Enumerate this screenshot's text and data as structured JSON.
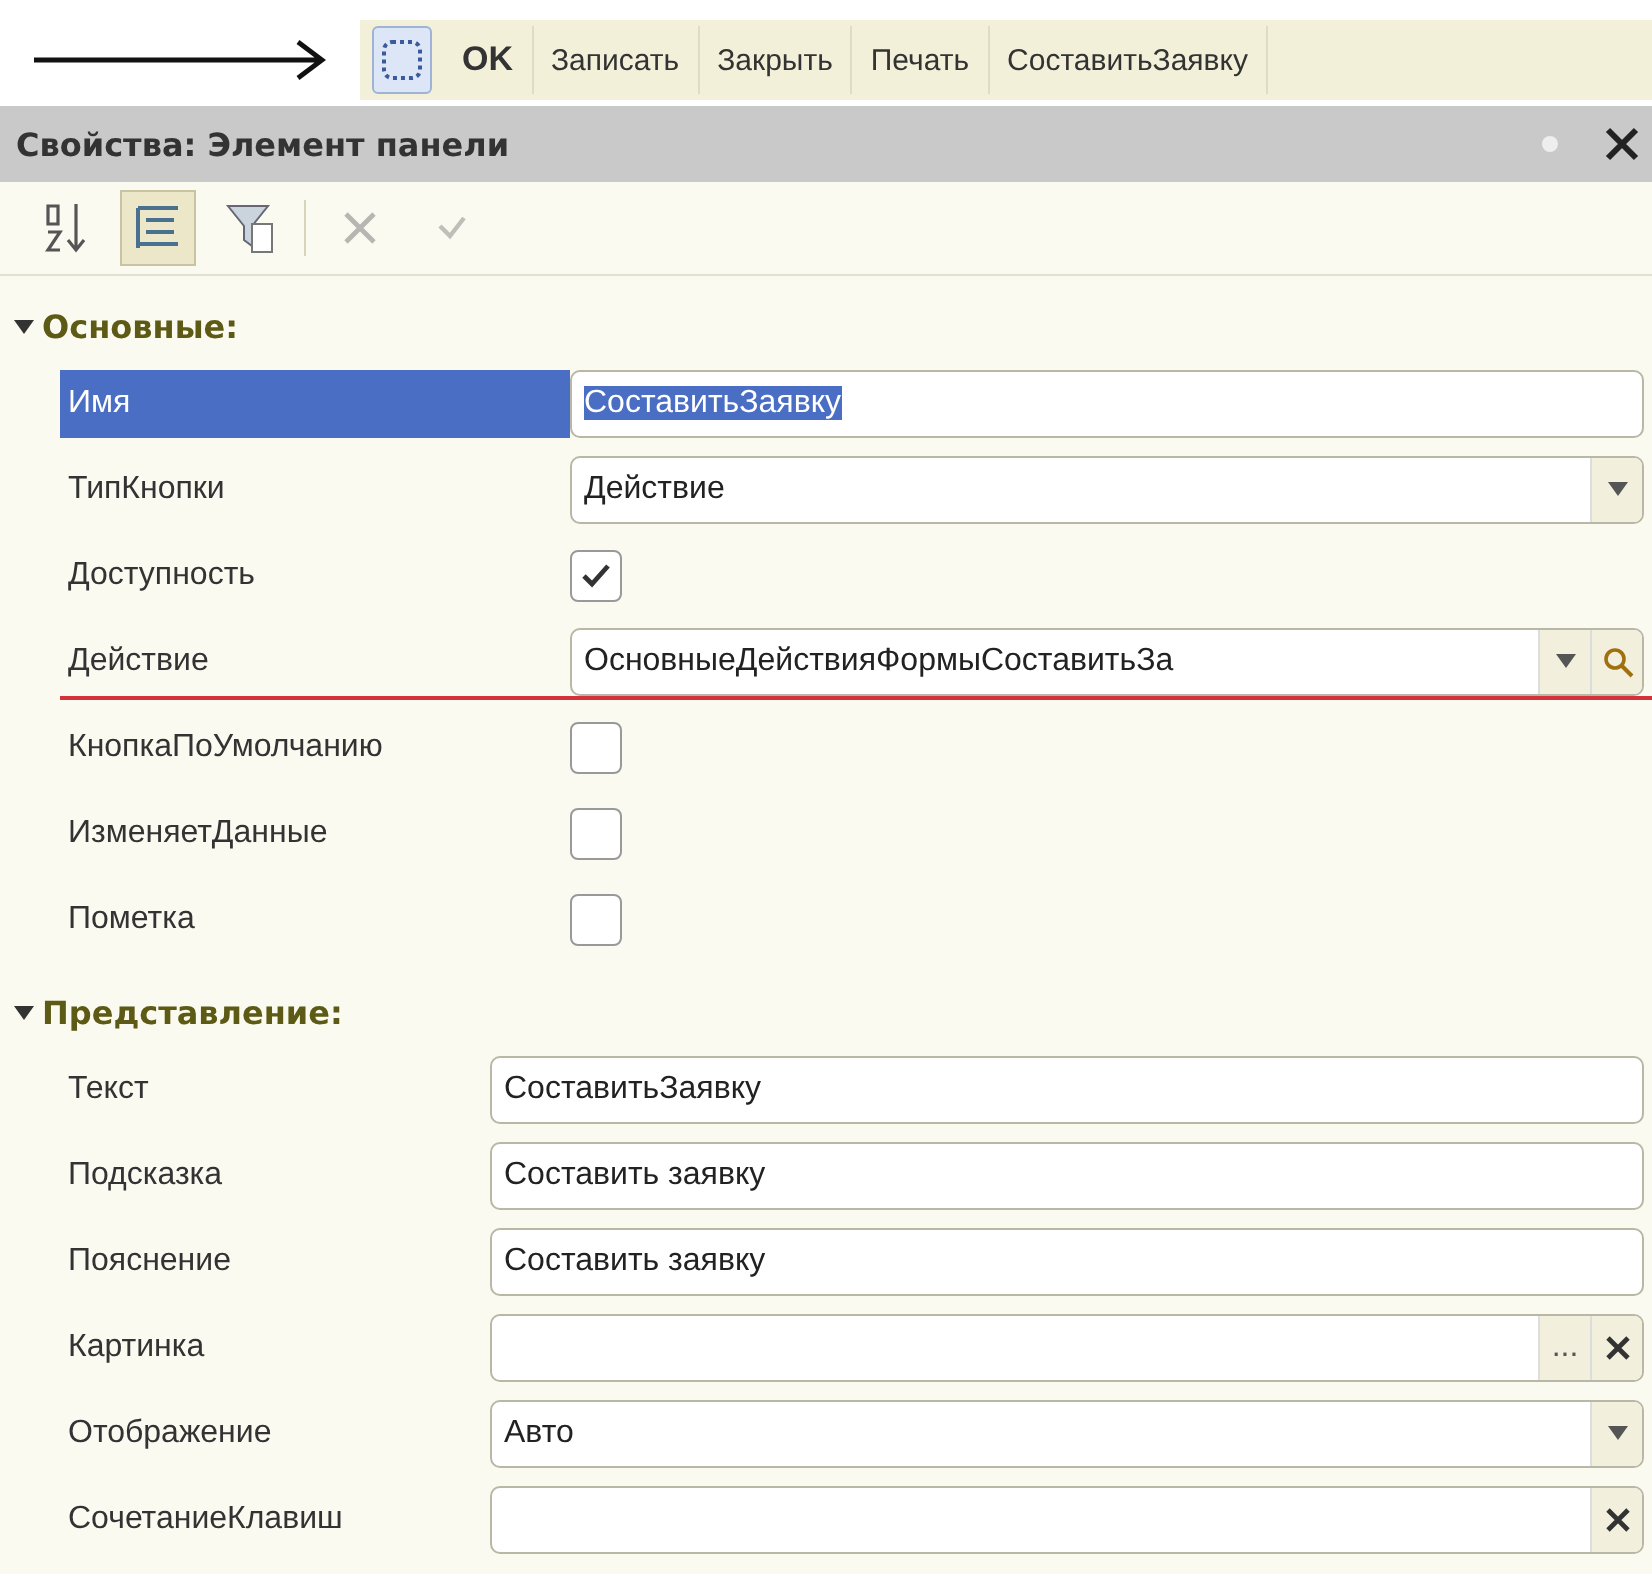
{
  "command_bar": {
    "items": [
      {
        "kind": "icon",
        "selected": true
      },
      {
        "kind": "text",
        "label": "OK",
        "bold": true
      },
      {
        "kind": "text",
        "label": "Записать",
        "bold": false
      },
      {
        "kind": "text",
        "label": "Закрыть",
        "bold": false
      },
      {
        "kind": "text",
        "label": "Печать",
        "bold": false
      },
      {
        "kind": "text",
        "label": "СоставитьЗаявку",
        "bold": false
      }
    ]
  },
  "panel": {
    "title": "Свойства: Элемент панели",
    "tools": [
      {
        "kind": "sort",
        "pressed": false,
        "disabled": false
      },
      {
        "kind": "tree",
        "pressed": true,
        "disabled": false
      },
      {
        "kind": "filter",
        "pressed": false,
        "disabled": false
      },
      {
        "kind": "delete",
        "pressed": false,
        "disabled": true
      },
      {
        "kind": "accept",
        "pressed": false,
        "disabled": true
      }
    ],
    "sections": [
      {
        "title": "Основные:",
        "expanded": true,
        "rows": [
          {
            "label": "Имя",
            "kind": "text",
            "value": "СоставитьЗаявку",
            "selected": true
          },
          {
            "label": "ТипКнопки",
            "kind": "dropdown",
            "value": "Действие",
            "selected": false
          },
          {
            "label": "Доступность",
            "kind": "checkbox",
            "checked": true,
            "selected": false
          },
          {
            "label": "Действие",
            "kind": "lookup",
            "value": "ОсновныеДействияФормыСоставитьЗа",
            "selected": false,
            "underlined": true
          },
          {
            "label": "КнопкаПоУмолчанию",
            "kind": "checkbox",
            "checked": false,
            "selected": false
          },
          {
            "label": "ИзменяетДанные",
            "kind": "checkbox",
            "checked": false,
            "selected": false
          },
          {
            "label": "Пометка",
            "kind": "checkbox",
            "checked": false,
            "selected": false
          }
        ]
      },
      {
        "title": "Представление:",
        "expanded": true,
        "rows": [
          {
            "label": "Текст",
            "kind": "text",
            "value": "СоставитьЗаявку",
            "selected": false
          },
          {
            "label": "Подсказка",
            "kind": "text",
            "value": "Составить заявку",
            "selected": false
          },
          {
            "label": "Пояснение",
            "kind": "text",
            "value": "Составить заявку",
            "selected": false
          },
          {
            "label": "Картинка",
            "kind": "picker",
            "ellipsis": "...",
            "selected": false
          },
          {
            "label": "Отображение",
            "kind": "dropdown",
            "value": "Авто",
            "selected": false
          },
          {
            "label": "СочетаниеКлавиш",
            "kind": "clearable",
            "selected": false
          }
        ]
      }
    ]
  }
}
